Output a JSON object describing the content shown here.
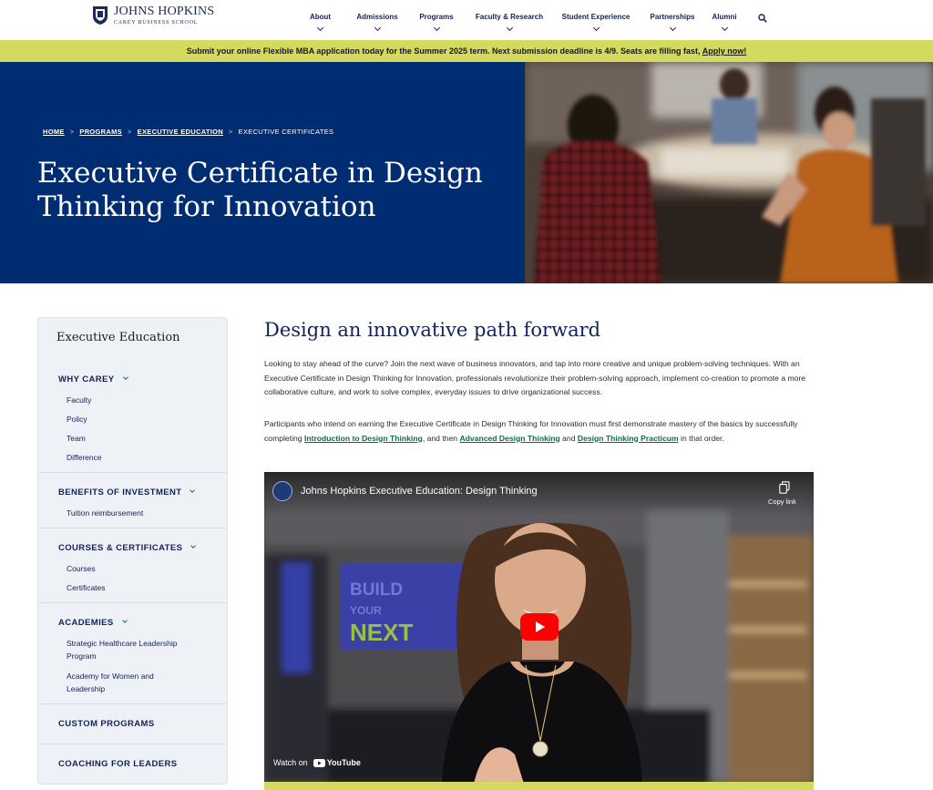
{
  "brand": {
    "name": "JOHNS HOPKINS",
    "subtitle": "CAREY BUSINESS SCHOOL"
  },
  "nav": {
    "items": [
      {
        "label": "About"
      },
      {
        "label": "Admissions"
      },
      {
        "label": "Programs"
      },
      {
        "label": "Faculty & Research"
      },
      {
        "label": "Student Experience"
      },
      {
        "label": "Partnerships"
      },
      {
        "label": "Alumni"
      }
    ],
    "search_icon": "search-icon"
  },
  "alert": {
    "text": "Submit your online Flexible MBA application today for the Summer 2025 term. Next submission deadline is 4/9. Seats are filling fast,",
    "link_label": "Apply now!"
  },
  "hero": {
    "breadcrumb": {
      "home": "HOME",
      "programs": "PROGRAMS",
      "exec_ed": "EXECUTIVE EDUCATION",
      "current": "EXECUTIVE CERTIFICATES",
      "separator": ">"
    },
    "title": "Executive Certificate in Design Thinking for Innovation"
  },
  "sidebar": {
    "title": "Executive Education",
    "sections": [
      {
        "label": "WHY CAREY",
        "links": [
          "Faculty",
          "Policy",
          "Team",
          "Difference"
        ]
      },
      {
        "label": "BENEFITS OF INVESTMENT",
        "links": [
          "Tuition reimbursement"
        ]
      },
      {
        "label": "COURSES & CERTIFICATES",
        "links": [
          "Courses",
          "Certificates"
        ]
      },
      {
        "label": "ACADEMIES",
        "links": [
          "Strategic Healthcare Leadership Program",
          "Academy for Women and Leadership"
        ]
      },
      {
        "label": "CUSTOM PROGRAMS",
        "links": []
      },
      {
        "label": "COACHING FOR LEADERS",
        "links": []
      }
    ]
  },
  "main": {
    "heading": "Design an innovative path forward",
    "intro": "Looking to stay ahead of the curve? Join the next wave of business innovators, and tap into more creative and unique problem-solving techniques. With an Executive Certificate in Design Thinking for Innovation, professionals revolutionize their problem-solving approach, implement co-creation to promote a more collaborative culture, and work to solve complex, everyday issues to drive organizational success.",
    "req_before": "Participants who intend on earning the Executive Certificate in Design Thinking for Innovation must first demonstrate mastery of the basics by successfully completing ",
    "req_link1": "Introduction to Design Thinking",
    "req_mid1": ", and then ",
    "req_link2": "Advanced Design Thinking",
    "req_mid2": " and ",
    "req_link3": "Design Thinking Practicum",
    "req_after": " in that order."
  },
  "video": {
    "title": "Johns Hopkins Executive Education: Design Thinking",
    "copy_link": "Copy link",
    "watch_on": "Watch on",
    "youtube": "YouTube",
    "screen_text_1": "BUILD",
    "screen_text_2": "YOUR",
    "screen_text_3": "NEXT"
  },
  "colors": {
    "navy": "#002d72",
    "accent_green": "#d4da5e",
    "link_green": "#0e6b4a",
    "youtube_red": "#ff0000"
  }
}
